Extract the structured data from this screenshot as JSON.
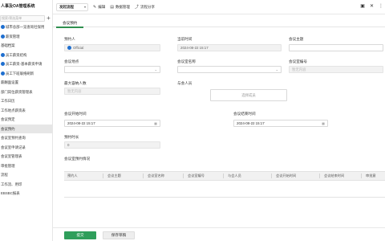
{
  "sidebar": {
    "title": "人事及OA管理系统",
    "search_placeholder": "搜索/筛选菜单",
    "items": [
      {
        "label": "城市总部一览查询社保用"
      },
      {
        "label": "薪资管理"
      },
      {
        "label": "基础档案"
      },
      {
        "label": "员工薪资结构"
      },
      {
        "label": "员工薪资-基本薪资申请"
      },
      {
        "label": "员工下班联络刷新"
      },
      {
        "label": "薪酬面设置"
      },
      {
        "label": "部门岗位薪资管理表"
      },
      {
        "label": "工作日历"
      },
      {
        "label": "工作地点薪资表"
      },
      {
        "label": "会议预定"
      },
      {
        "label": "会议预约"
      },
      {
        "label": "会议室预约查询"
      },
      {
        "label": "会议室申请记录"
      },
      {
        "label": "会议室管理表"
      },
      {
        "label": "审批管理"
      },
      {
        "label": "流程"
      },
      {
        "label": "工作流、用印"
      },
      {
        "label": "EBSBC报表"
      }
    ]
  },
  "topbar": {
    "dropdown": "发起流程",
    "actions": [
      {
        "icon": "edit-icon",
        "glyph": "✎",
        "label": "编辑"
      },
      {
        "icon": "data-icon",
        "glyph": "▤",
        "label": "数据管理"
      },
      {
        "icon": "share-icon",
        "glyph": "⤴",
        "label": "流程分享"
      }
    ],
    "right_icons": [
      "print-icon",
      "close-icon",
      "more-icon"
    ]
  },
  "tab": {
    "label": "会议预约"
  },
  "form": {
    "booker_label": "预约人",
    "booker_value": "Official",
    "time_label": "当前时间",
    "time_value": "2024-08-22 15:17",
    "subject_label": "会议主题",
    "location_label": "会议地点",
    "room_name_label": "会议室名称",
    "room_no_label": "会议室编号",
    "room_no_placeholder": "暂无内容",
    "capacity_label": "最大容纳人数",
    "capacity_placeholder": "暂无内容",
    "attendees_label": "与会人员",
    "attendees_placeholder": "选择成员",
    "start_label": "会议开始时间",
    "start_value": "2024-08-22 15:17",
    "end_label": "会议结束时间",
    "end_value": "2024-08-22 15:17",
    "duration_label": "预约时长",
    "duration_value": "0"
  },
  "booked": {
    "title": "会议室预约情况",
    "columns": [
      "预约人",
      "会议主题",
      "会议室名称",
      "会议室编号",
      "与会人员",
      "会议开始时间",
      "会议结束时间",
      "审批意"
    ]
  },
  "footer": {
    "submit": "提交",
    "save_draft": "保存草稿"
  }
}
